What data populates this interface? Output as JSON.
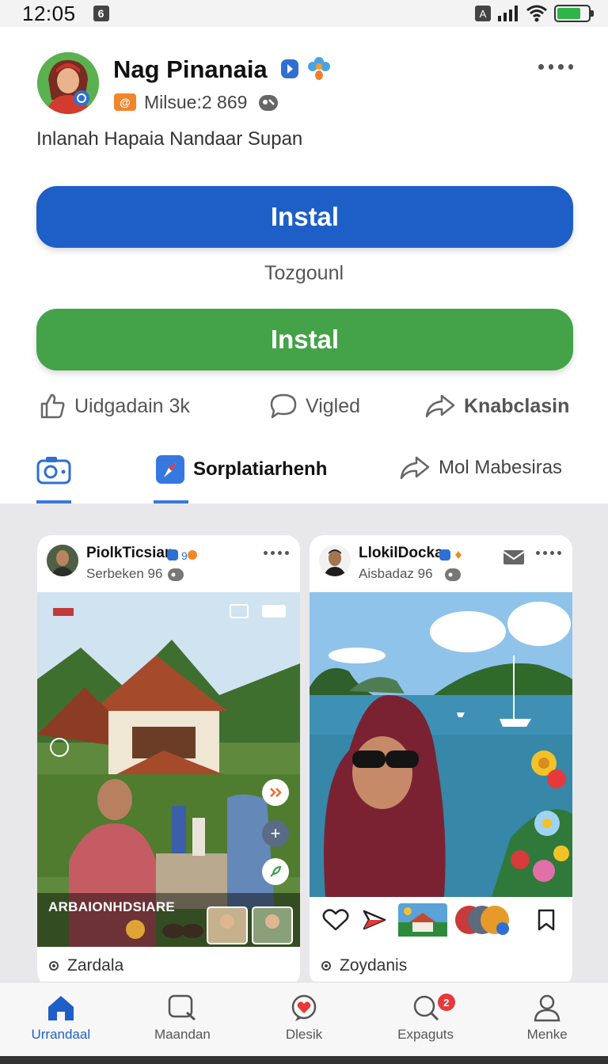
{
  "status_bar": {
    "time": "12:05",
    "battery_level": 0.75
  },
  "profile": {
    "name": "Nag Pinanaia",
    "meta": "Milsue:2 869",
    "description": "Inlanah Hapaia Nandaar Supan",
    "primary_button": "Instal",
    "toggle_label": "Tozgounl",
    "secondary_button": "Instal"
  },
  "actions": {
    "like_label": "Uidgadain 3k",
    "comment_label": "Vigled",
    "share_label": "Knabclasin"
  },
  "tabs": [
    {
      "label": ""
    },
    {
      "label": "Sorplatiarhenh"
    },
    {
      "label": "Mol Mabesiras"
    }
  ],
  "posts": [
    {
      "author": "PiolkTicsian",
      "subtitle": "Serbeken 96",
      "overlay_text": "ARBAIONHDSIARE",
      "caption": "Zardala"
    },
    {
      "author": "LlokilDocka",
      "subtitle": "Aisbadaz 96",
      "caption": "Zoydanis"
    }
  ],
  "nav": [
    {
      "label": "Urrandaal",
      "icon": "home-icon",
      "active": true
    },
    {
      "label": "Maandan",
      "icon": "message-icon",
      "active": false
    },
    {
      "label": "Dlesik",
      "icon": "heart-chat-icon",
      "active": false
    },
    {
      "label": "Expaguts",
      "icon": "search-icon",
      "active": false,
      "badge": "2"
    },
    {
      "label": "Menke",
      "icon": "profile-icon",
      "active": false
    }
  ],
  "colors": {
    "primary_blue": "#1d5fc7",
    "install_green": "#44a249",
    "active_tab": "#3a78d8",
    "badge_red": "#e5393b"
  }
}
